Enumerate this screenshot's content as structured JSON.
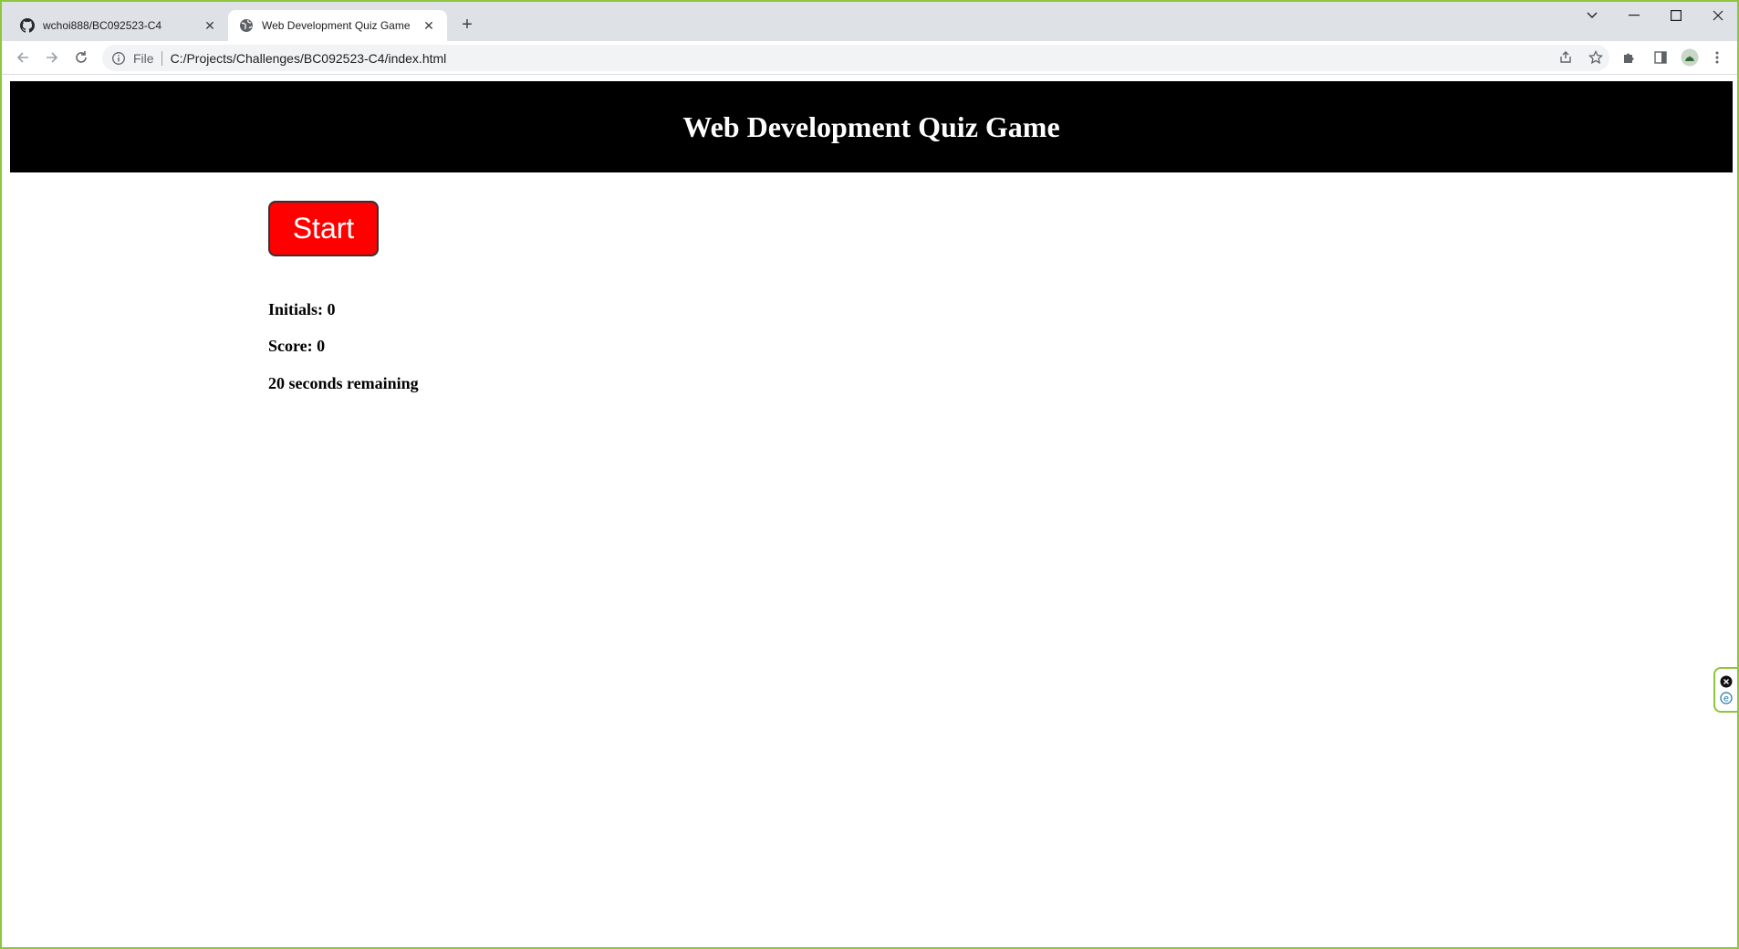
{
  "browser": {
    "tabs": [
      {
        "title": "wchoi888/BC092523-C4",
        "icon": "github-icon",
        "active": false
      },
      {
        "title": "Web Development Quiz Game",
        "icon": "globe-icon",
        "active": true
      }
    ],
    "address_bar": {
      "scheme_label": "File",
      "url": "C:/Projects/Challenges/BC092523-C4/index.html"
    }
  },
  "page": {
    "header_title": "Web Development Quiz Game",
    "start_button": "Start",
    "initials_line": "Initials: 0",
    "score_line": "Score: 0",
    "timer_line": "20 seconds remaining"
  },
  "colors": {
    "header_bg": "#000000",
    "start_button_bg": "#ff0000",
    "window_border": "#8cc63f"
  }
}
